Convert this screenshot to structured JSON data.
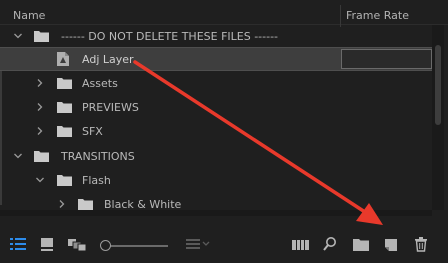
{
  "header": {
    "name_col": "Name",
    "frame_rate_col": "Frame Rate"
  },
  "rows": [
    {
      "label": "------  DO NOT DELETE THESE FILES  ------",
      "kind": "folder",
      "expanded": true,
      "depth": 0
    },
    {
      "label": "Adj Layer",
      "kind": "adjustment-layer",
      "selected": true,
      "depth": 1
    },
    {
      "label": "Assets",
      "kind": "folder",
      "expanded": false,
      "depth": 1
    },
    {
      "label": "PREVIEWS",
      "kind": "folder",
      "expanded": false,
      "depth": 1
    },
    {
      "label": "SFX",
      "kind": "folder",
      "expanded": false,
      "depth": 1
    },
    {
      "label": "TRANSITIONS",
      "kind": "folder",
      "expanded": true,
      "depth": 0
    },
    {
      "label": "Flash",
      "kind": "folder",
      "expanded": true,
      "depth": 1
    },
    {
      "label": "Black & White",
      "kind": "folder",
      "expanded": false,
      "depth": 2
    }
  ],
  "toolbar": {
    "icons": [
      "list-view-icon",
      "icon-view-icon",
      "freeform-view-icon",
      "zoom-slider",
      "sort-icon",
      "automate-to-sequence-icon",
      "find-icon",
      "new-bin-icon",
      "new-item-icon",
      "delete-icon"
    ],
    "accent": "#2d8ceb"
  },
  "annotation": {
    "color": "#e8392b"
  }
}
